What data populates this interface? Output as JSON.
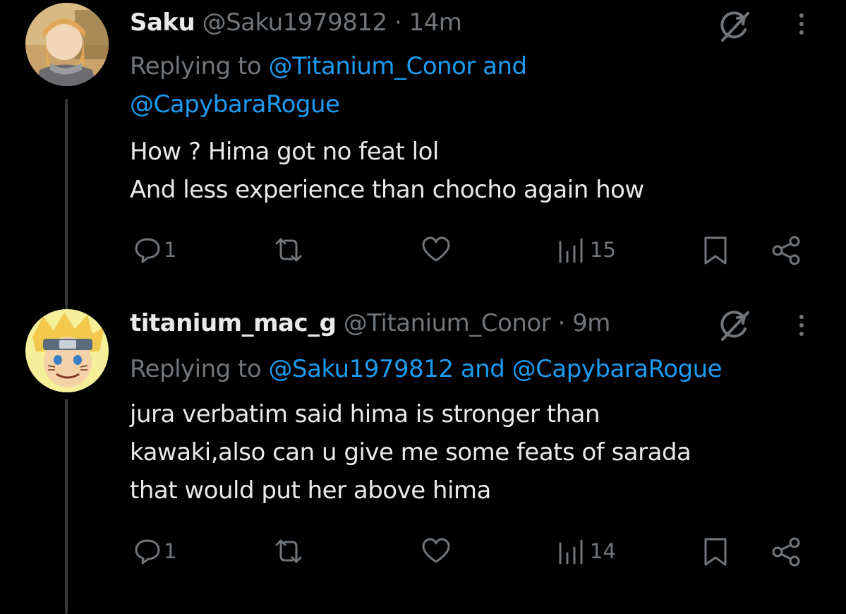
{
  "tweets": [
    {
      "name": "Saku",
      "handle": "@Saku1979812",
      "separator": "·",
      "time": "14m",
      "replying_prefix": "Replying to",
      "replying_line1": "@Titanium_Conor and",
      "replying_line2": "@CapybaraRogue",
      "body_lines": [
        "How ? Hima got no feat lol",
        "And less experience than chocho again how"
      ],
      "reply_count": "1",
      "views": "15"
    },
    {
      "name": "titanium_mac_g",
      "handle": "@Titanium_Conor",
      "separator": "·",
      "time": "9m",
      "replying_prefix": "Replying to",
      "replying_line1": "@Saku1979812 and @CapybaraRogue",
      "body_lines": [
        "jura verbatim said hima is stronger than",
        "kawaki,also can u give me some feats of sarada",
        "that would put her above hima"
      ],
      "reply_count": "1",
      "views": "14"
    }
  ],
  "icons": [
    "reply-icon",
    "retweet-icon",
    "like-icon",
    "views-icon",
    "bookmark-icon",
    "share-icon",
    "grok-icon",
    "more-icon"
  ],
  "colors": {
    "background": "#000000",
    "text": "#e7e9ea",
    "muted": "#71767b",
    "link": "#1d9bf0"
  }
}
